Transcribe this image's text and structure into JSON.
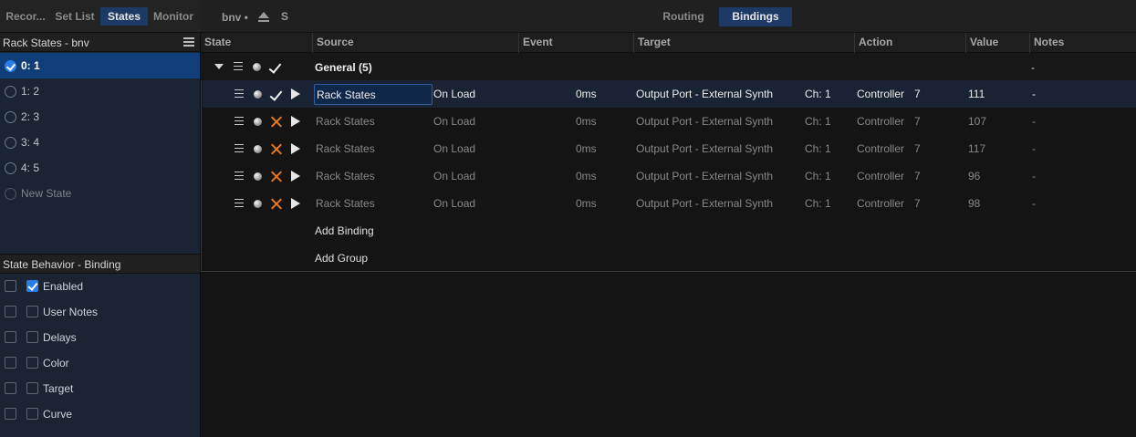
{
  "top_tabs": [
    {
      "label": "Recor...",
      "active": false
    },
    {
      "label": "Set List",
      "active": false
    },
    {
      "label": "States",
      "active": true
    },
    {
      "label": "Monitor",
      "active": false
    }
  ],
  "states_panel": {
    "title": "Rack States - bnv",
    "items": [
      {
        "label": "0: 1",
        "selected": true
      },
      {
        "label": "1: 2",
        "selected": false
      },
      {
        "label": "2: 3",
        "selected": false
      },
      {
        "label": "3: 4",
        "selected": false
      },
      {
        "label": "4: 5",
        "selected": false
      }
    ],
    "new_state_label": "New State"
  },
  "behavior_panel": {
    "title": "State Behavior - Binding",
    "options": [
      {
        "label": "Enabled",
        "checked": true
      },
      {
        "label": "User Notes",
        "checked": false
      },
      {
        "label": "Delays",
        "checked": false
      },
      {
        "label": "Color",
        "checked": false
      },
      {
        "label": "Target",
        "checked": false
      },
      {
        "label": "Curve",
        "checked": false
      }
    ]
  },
  "toolbar": {
    "doc_name": "bnv •",
    "save_label": "S",
    "view_tabs": [
      {
        "label": "Routing",
        "active": false
      },
      {
        "label": "Bindings",
        "active": true
      }
    ]
  },
  "columns": [
    "State",
    "Source",
    "Event",
    "Target",
    "Action",
    "Value",
    "Notes"
  ],
  "group": {
    "title": "General (5)",
    "notes": "-"
  },
  "bindings": [
    {
      "source": "Rack States",
      "event": "On Load",
      "delay": "0ms",
      "target": "Output Port - External Synth",
      "channel": "Ch: 1",
      "action": "Controller",
      "cc": "7",
      "value": "111",
      "notes": "-",
      "enabled": true,
      "selected": true
    },
    {
      "source": "Rack States",
      "event": "On Load",
      "delay": "0ms",
      "target": "Output Port - External Synth",
      "channel": "Ch: 1",
      "action": "Controller",
      "cc": "7",
      "value": "107",
      "notes": "-",
      "enabled": false,
      "selected": false
    },
    {
      "source": "Rack States",
      "event": "On Load",
      "delay": "0ms",
      "target": "Output Port - External Synth",
      "channel": "Ch: 1",
      "action": "Controller",
      "cc": "7",
      "value": "117",
      "notes": "-",
      "enabled": false,
      "selected": false
    },
    {
      "source": "Rack States",
      "event": "On Load",
      "delay": "0ms",
      "target": "Output Port - External Synth",
      "channel": "Ch: 1",
      "action": "Controller",
      "cc": "7",
      "value": "96",
      "notes": "-",
      "enabled": false,
      "selected": false
    },
    {
      "source": "Rack States",
      "event": "On Load",
      "delay": "0ms",
      "target": "Output Port - External Synth",
      "channel": "Ch: 1",
      "action": "Controller",
      "cc": "7",
      "value": "98",
      "notes": "-",
      "enabled": false,
      "selected": false
    }
  ],
  "add_binding_label": "Add Binding",
  "add_group_label": "Add Group"
}
